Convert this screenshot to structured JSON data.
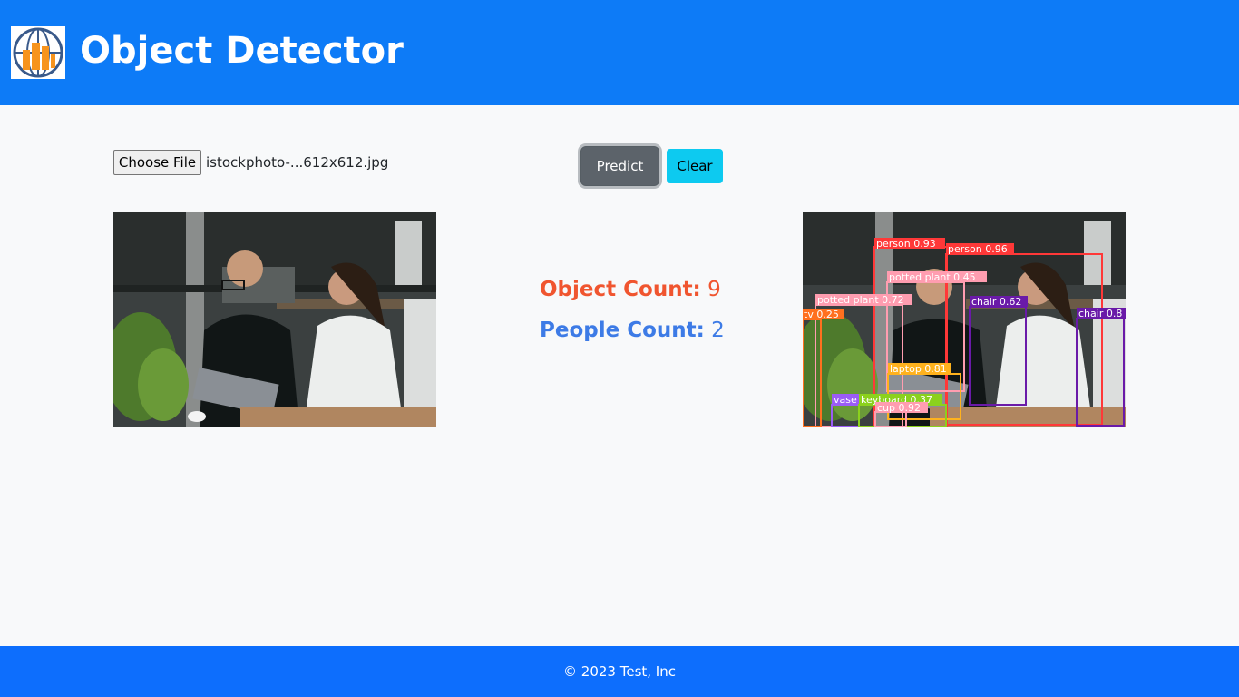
{
  "header": {
    "title": "Object Detector",
    "logo_icon": "globe-building-logo-icon"
  },
  "upload": {
    "choose_file_label": "Choose File",
    "file_name": "istockphoto-...612x612.jpg"
  },
  "actions": {
    "predict_label": "Predict",
    "clear_label": "Clear"
  },
  "results": {
    "object_count_label": "Object Count:",
    "object_count_value": "9",
    "people_count_label": "People Count:",
    "people_count_value": "2"
  },
  "detections": [
    "person 0.93",
    "person 0.96",
    "potted plant 0.45",
    "potted plant 0.72",
    "chair 0.62",
    "chair 0.8",
    "tv 0.25",
    "laptop 0.81",
    "vase",
    "keyboard 0.37",
    "cup 0.92"
  ],
  "footer": {
    "copyright": "© 2023 Test, Inc"
  },
  "colors": {
    "header_bg": "#0d7bf7",
    "footer_bg": "#0d6efd",
    "object_count": "#f0552f",
    "people_count": "#3d7be6",
    "predict_bg": "#5c636a",
    "clear_bg": "#0dcaf0"
  }
}
